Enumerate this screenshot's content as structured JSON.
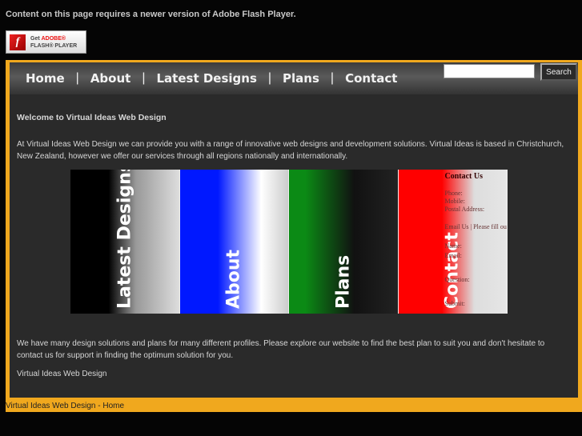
{
  "flash": {
    "message": "Content on this page requires a newer version of Adobe Flash Player.",
    "badge_get": "Get",
    "badge_adobe": "ADOBE®",
    "badge_product": "FLASH® PLAYER"
  },
  "nav": {
    "items": [
      "Home",
      "About",
      "Latest Designs",
      "Plans",
      "Contact"
    ],
    "search_placeholder": "",
    "search_label": "Search"
  },
  "content": {
    "heading": "Welcome to Virtual Ideas Web Design",
    "intro": "At Virtual Ideas Web Design we can provide you with a range of innovative web designs and development solutions. Virtual Ideas is based in Christchurch, New Zealand, however we offer our services through all regions nationally and internationally.",
    "banner": [
      "Latest Designs",
      "About",
      "Plans",
      "Contact"
    ],
    "banner_contact": {
      "title": "Contact Us",
      "lines": [
        "Phone:",
        "Mobile:",
        "Postal Address:",
        "Email Us | Please fill ou",
        "Name:",
        "Email:",
        "Question:",
        "Submit:"
      ]
    },
    "body": "We have many design solutions and plans for many different profiles. Please explore our website to find the best plan to suit you and don't hesitate to contact us for support in finding the optimum solution for you.",
    "signature": "Virtual Ideas Web Design"
  },
  "footer": {
    "text": "Virtual Ideas Web Design - Home"
  }
}
